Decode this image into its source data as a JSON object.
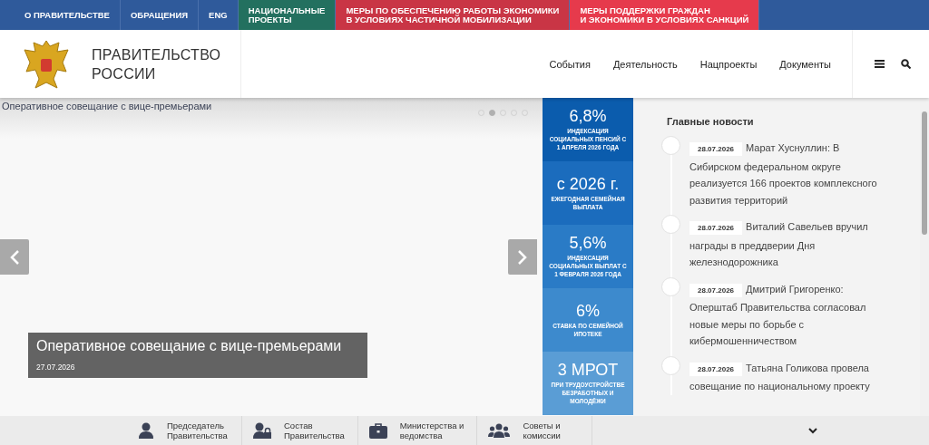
{
  "top_nav": [
    {
      "label": "О ПРАВИТЕЛЬСТВЕ",
      "kind": "plain"
    },
    {
      "label": "ОБРАЩЕНИЯ",
      "kind": "plain"
    },
    {
      "label": "ENG",
      "kind": "plain"
    },
    {
      "label": "НАЦИОНАЛЬНЫЕ\nПРОЕКТЫ",
      "kind": "green"
    },
    {
      "label": "МЕРЫ ПО ОБЕСПЕЧЕНИЮ РАБОТЫ ЭКОНОМИКИ\nВ УСЛОВИЯХ ЧАСТИЧНОЙ МОБИЛИЗАЦИИ",
      "kind": "red"
    },
    {
      "label": "МЕРЫ ПОДДЕРЖКИ ГРАЖДАН\nИ ЭКОНОМИКИ В УСЛОВИЯХ САНКЦИЙ",
      "kind": "pink"
    }
  ],
  "header": {
    "title": "ПРАВИТЕЛЬСТВО\nРОССИИ",
    "menu": [
      "События",
      "Деятельность",
      "Нацпроекты",
      "Документы"
    ]
  },
  "slider": {
    "image_alt": "Оперативное совещание с вице-премьерами",
    "caption": "Оперативное совещание с вице-премьерами",
    "date": "27.07.2026",
    "dots": [
      {
        "selected": false
      },
      {
        "selected": true
      },
      {
        "selected": false
      },
      {
        "selected": false
      },
      {
        "selected": false
      }
    ]
  },
  "stats": [
    {
      "value": "6,8%",
      "text": "ИНДЕКСАЦИЯ СОЦИАЛЬНЫХ ПЕНСИЙ С 1 АПРЕЛЯ 2026 ГОДА",
      "color": "#0b5cad"
    },
    {
      "value": "с 2026 г.",
      "text": "ЕЖЕГОДНАЯ СЕМЕЙНАЯ ВЫПЛАТА",
      "color": "#1b6cbd"
    },
    {
      "value": "5,6%",
      "text": "ИНДЕКСАЦИЯ СОЦИАЛЬНЫХ ВЫПЛАТ С 1 ФЕВРАЛЯ 2026 ГОДА",
      "color": "#2a7bc6"
    },
    {
      "value": "6%",
      "text": "СТАВКА ПО СЕМЕЙНОЙ ИПОТЕКЕ",
      "color": "#3d8acd"
    },
    {
      "value": "3 МРОТ",
      "text": "ПРИ ТРУДОУСТРОЙСТВЕ БЕЗРАБОТНЫХ И МОЛОДЁЖИ",
      "color": "#5a9dd5"
    }
  ],
  "news": {
    "title": "Главные новости",
    "items": [
      {
        "date": "28.07.2026",
        "text": "Марат Хуснуллин: В Сибирском федеральном округе реализуется 166 проектов комплексного развития территорий"
      },
      {
        "date": "28.07.2026",
        "text": "Виталий Савельев вручил награды в преддверии Дня железнодорожника"
      },
      {
        "date": "28.07.2026",
        "text": "Дмитрий Григоренко: Оперштаб Правительства согласовал новые меры по борьбе с кибермошенничеством"
      },
      {
        "date": "28.07.2026",
        "text": "Татьяна Голикова провела совещание по национальному проекту"
      }
    ]
  },
  "bottom_bar": [
    {
      "label": "Председатель\nПравительства",
      "kind": "person"
    },
    {
      "label": "Состав\nПравительства",
      "kind": "team"
    },
    {
      "label": "Министерства и\nведомства",
      "kind": "briefcase"
    },
    {
      "label": "Советы и\nкомиссии",
      "kind": "group"
    }
  ]
}
